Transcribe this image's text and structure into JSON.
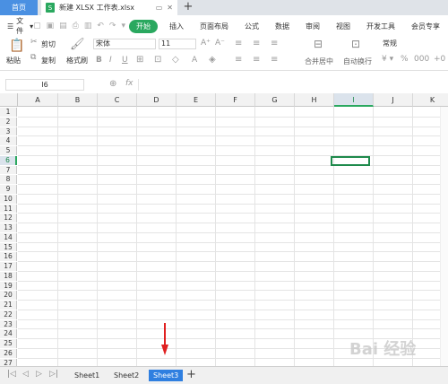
{
  "tabs": {
    "home": "首页",
    "file": "新建 XLSX 工作表.xlsx",
    "new_tab": "+"
  },
  "menu": {
    "file": "文件",
    "items": [
      "开始",
      "插入",
      "页面布局",
      "公式",
      "数据",
      "审阅",
      "视图",
      "开发工具",
      "会员专享"
    ]
  },
  "ribbon": {
    "paste": "粘贴",
    "cut": "剪切",
    "copy": "复制",
    "format_painter": "格式刷",
    "font_name": "宋体",
    "font_size": "11",
    "merge": "合并居中",
    "wrap": "自动换行",
    "number_format": "常规"
  },
  "formula_bar": {
    "name_box": "I6",
    "fx": "fx"
  },
  "columns": [
    "A",
    "B",
    "C",
    "D",
    "E",
    "F",
    "G",
    "H",
    "I",
    "J",
    "K"
  ],
  "selected_column": "I",
  "rows": [
    "1",
    "2",
    "3",
    "4",
    "5",
    "6",
    "7",
    "8",
    "9",
    "10",
    "11",
    "12",
    "13",
    "14",
    "15",
    "16",
    "17",
    "18",
    "19",
    "20",
    "21",
    "22",
    "23",
    "24",
    "25",
    "26",
    "27"
  ],
  "selected_row": "6",
  "sheets": [
    "Sheet1",
    "Sheet2",
    "Sheet3"
  ],
  "active_sheet": "Sheet3",
  "add_sheet": "+",
  "watermark": "Bai 经验",
  "colors": {
    "accent_green": "#2aa85f",
    "sheet_active": "#2f7fe0",
    "arrow_red": "#e02020"
  }
}
